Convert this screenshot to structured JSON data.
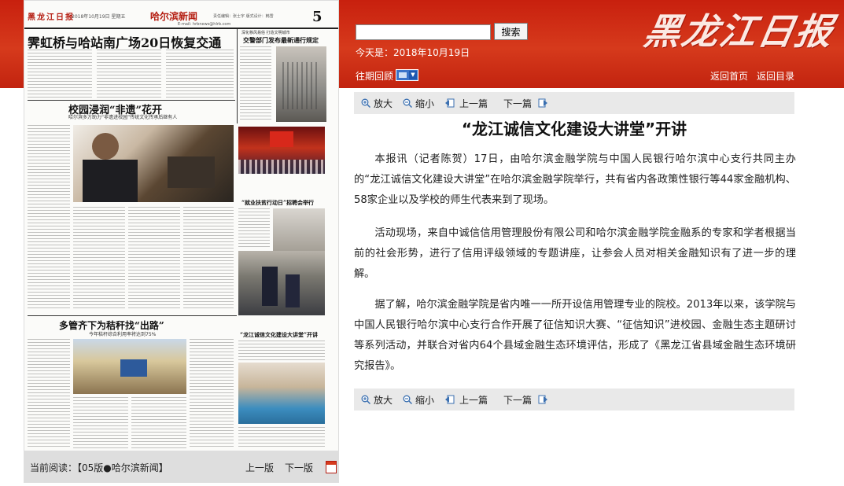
{
  "header": {
    "search_placeholder": "",
    "search_button": "搜索",
    "today": "今天是：2018年10月19日",
    "logo_text": "黑龙江日报",
    "past_review_label": "往期回顾",
    "home_link": "返回首页",
    "toc_link": "返回目录"
  },
  "newspaper": {
    "brand": "黑龙江日报",
    "date_line": "2018年10月19日 星期五",
    "section": "哈尔滨新闻",
    "page_no": "5",
    "email": "E-mail: hrbnews@hlrb.com",
    "editor_line": "责任编辑：张士宇 版式设计：韩雪",
    "headline_main": "霁虹桥与哈站南广场20日恢复交通",
    "headline_school": "校园浸润“非遗”花开",
    "sub_school": "哈尔滨多方助力“非遗进校园”传统文化传承后继有人",
    "headline_traffic_kicker": "深化移风易俗 打造文明城市",
    "headline_traffic": "交警部门发布最新通行规定",
    "headline_jobs": "“就业扶贫行动日”招聘会举行",
    "headline_straw": "多管齐下为秸秆找“出路”",
    "sub_straw": "今年秸秆综合利用率将达到75%",
    "headline_lecture": "“龙江诚信文化建设大讲堂”开讲"
  },
  "footer": {
    "current_reading": "当前阅读：【05版●哈尔滨新闻】",
    "prev_page": "上一版",
    "next_page": "下一版"
  },
  "toolbar": {
    "zoom_in": "放大",
    "zoom_out": "缩小",
    "prev_article": "上一篇",
    "next_article": "下一篇"
  },
  "article": {
    "title": "“龙江诚信文化建设大讲堂”开讲",
    "paragraphs": [
      "本报讯（记者陈贺）17日，由哈尔滨金融学院与中国人民银行哈尔滨中心支行共同主办的“龙江诚信文化建设大讲堂”在哈尔滨金融学院举行，共有省内各政策性银行等44家金融机构、58家企业以及学校的师生代表来到了现场。",
      "活动现场，来自中诚信信用管理股份有限公司和哈尔滨金融学院金融系的专家和学者根据当前的社会形势，进行了信用评级领域的专题讲座，让参会人员对相关金融知识有了进一步的理解。",
      "据了解，哈尔滨金融学院是省内唯一一所开设信用管理专业的院校。2013年以来，该学院与中国人民银行哈尔滨中心支行合作开展了征信知识大赛、“征信知识”进校园、金融生态主题研讨等系列活动，并联合对省内64个县域金融生态环境评估，形成了《黑龙江省县域金融生态环境研究报告》。"
    ]
  },
  "colors": {
    "header_red": "#d63a1c",
    "toolbar_bg": "#e9e9e9",
    "footer_bg": "#dedede"
  }
}
